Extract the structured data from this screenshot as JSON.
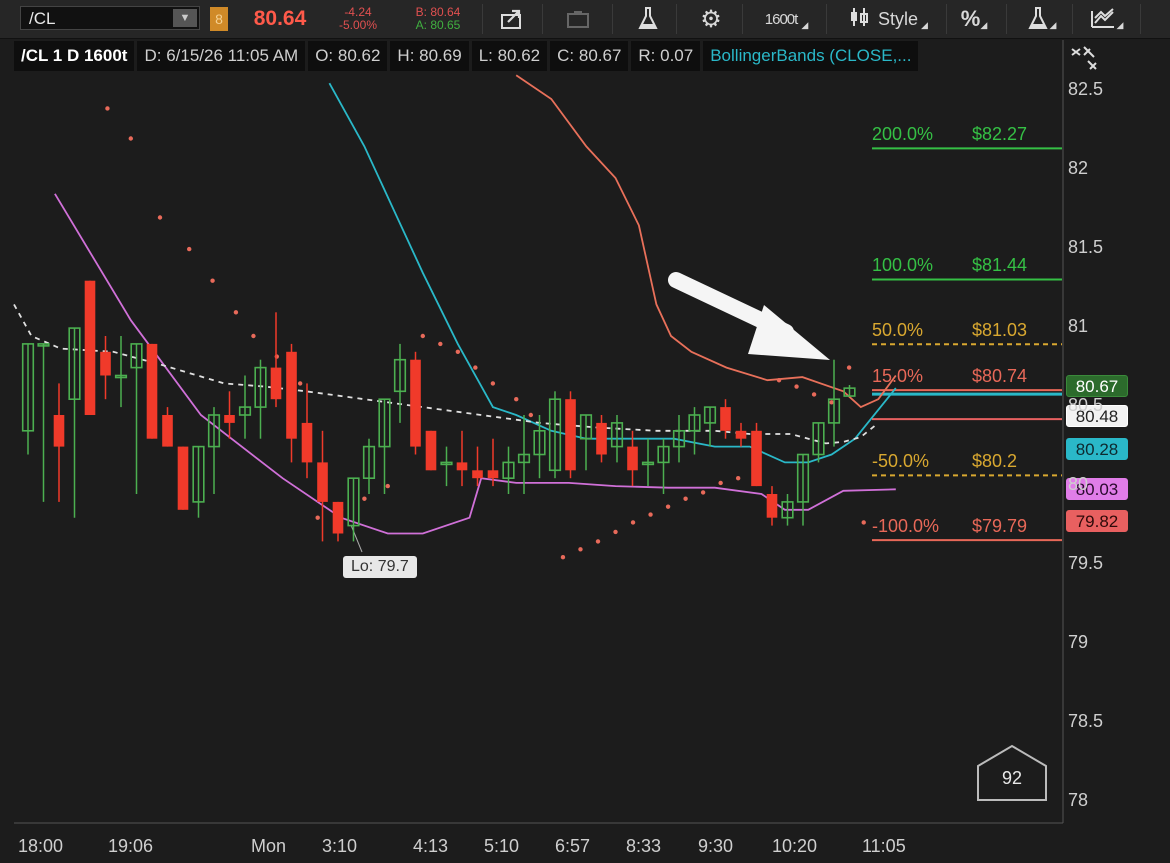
{
  "toolbar": {
    "symbol": "/CL",
    "link_badge": "8",
    "last_price": "80.64",
    "net_change": "-4.24",
    "pct_change": "-5.00%",
    "bid": "B: 80.64",
    "ask": "A: 80.65",
    "aggregation": "1600t",
    "style_label": "Style",
    "icons": [
      "share-icon",
      "screenshot-icon",
      "flask-icon",
      "gear-icon",
      "candle-style-icon",
      "percent-icon",
      "flask-icon",
      "drawing-icon"
    ]
  },
  "info": {
    "title": "/CL 1 D 1600t",
    "date": "D: 6/15/26 11:05 AM",
    "open": "O: 80.62",
    "high": "H: 80.69",
    "low": "L: 80.62",
    "close": "C: 80.67",
    "range": "R: 0.07",
    "study": "BollingerBands (CLOSE,..."
  },
  "colors": {
    "bg": "#1c1c1c",
    "up": "#4caf50",
    "down": "#f03a2a",
    "bb_upper": "#e8705a",
    "bb_lower": "#d070d8",
    "bb_mid": "#e0e0e0",
    "ma": "#2ab8c8",
    "sar": "#e86a5a",
    "fib_green": "#35c045",
    "fib_gold": "#d9a830",
    "fib_red": "#e86858"
  },
  "lo_label": "Lo: 79.7",
  "volume_badge": "92",
  "badges": [
    {
      "label": "80.67",
      "value": 80.67,
      "bg": "#2c6b2c",
      "fg": "#ffffff",
      "border": "#3a8a3a"
    },
    {
      "label": "80.48",
      "value": 80.48,
      "bg": "#f2f2f2",
      "fg": "#222222",
      "border": "#ffffff"
    },
    {
      "label": "80.28",
      "value": 80.28,
      "bg": "#2ab8c8",
      "fg": "#0e2a30",
      "border": "#2ab8c8"
    },
    {
      "label": "80.03",
      "value": 80.03,
      "bg": "#e07de8",
      "fg": "#2a0a2e",
      "border": "#e07de8"
    },
    {
      "label": "79.82",
      "value": 79.82,
      "bg": "#e86060",
      "fg": "#2e0a0a",
      "border": "#e86060"
    }
  ],
  "chart_data": {
    "type": "candlestick",
    "ylim": [
      78,
      82.6
    ],
    "y_ticks": [
      "82.5",
      "82",
      "81.5",
      "81",
      "80.5",
      "80",
      "79.5",
      "79",
      "78.5",
      "78"
    ],
    "x_labels": [
      "18:00",
      "19:06",
      "Mon",
      "3:10",
      "4:13",
      "5:10",
      "6:57",
      "8:33",
      "9:30",
      "10:20",
      "11:05"
    ],
    "fib_levels": [
      {
        "pct": "200.0%",
        "price": "$82.27",
        "value": 82.27,
        "color": "fib_green",
        "style": "solid"
      },
      {
        "pct": "100.0%",
        "price": "$81.44",
        "value": 81.44,
        "color": "fib_green",
        "style": "solid"
      },
      {
        "pct": "50.0%",
        "price": "$81.03",
        "value": 81.03,
        "color": "fib_gold",
        "style": "dashed"
      },
      {
        "pct": "15.0%",
        "price": "$80.74",
        "value": 80.74,
        "color": "fib_red",
        "style": "solid"
      },
      {
        "pct": "-50.0%",
        "price": "$80.2",
        "value": 80.2,
        "color": "fib_gold",
        "style": "dashed"
      },
      {
        "pct": "-100.0%",
        "price": "$79.79",
        "value": 79.79,
        "color": "fib_red",
        "style": "solid"
      }
    ],
    "candles": [
      {
        "o": 80.4,
        "h": 80.8,
        "l": 80.25,
        "c": 80.95
      },
      {
        "o": 80.95,
        "h": 80.95,
        "l": 79.95,
        "c": 80.95
      },
      {
        "o": 80.5,
        "h": 80.7,
        "l": 79.95,
        "c": 80.3
      },
      {
        "o": 80.6,
        "h": 80.9,
        "l": 79.85,
        "c": 81.05
      },
      {
        "o": 81.35,
        "h": 81.2,
        "l": 80.85,
        "c": 80.5
      },
      {
        "o": 80.9,
        "h": 81.0,
        "l": 80.6,
        "c": 80.75
      },
      {
        "o": 80.75,
        "h": 81.0,
        "l": 80.55,
        "c": 80.75
      },
      {
        "o": 80.8,
        "h": 80.95,
        "l": 80.0,
        "c": 80.95
      },
      {
        "o": 80.95,
        "h": 80.95,
        "l": 80.4,
        "c": 80.35
      },
      {
        "o": 80.5,
        "h": 80.55,
        "l": 80.3,
        "c": 80.3
      },
      {
        "o": 80.3,
        "h": 80.3,
        "l": 80.05,
        "c": 79.9
      },
      {
        "o": 79.95,
        "h": 80.3,
        "l": 79.85,
        "c": 80.3
      },
      {
        "o": 80.3,
        "h": 80.55,
        "l": 80.0,
        "c": 80.5
      },
      {
        "o": 80.5,
        "h": 80.65,
        "l": 80.35,
        "c": 80.45
      },
      {
        "o": 80.5,
        "h": 80.75,
        "l": 80.35,
        "c": 80.55
      },
      {
        "o": 80.55,
        "h": 80.85,
        "l": 80.35,
        "c": 80.8
      },
      {
        "o": 80.8,
        "h": 81.15,
        "l": 80.55,
        "c": 80.6
      },
      {
        "o": 80.9,
        "h": 80.95,
        "l": 80.2,
        "c": 80.35
      },
      {
        "o": 80.45,
        "h": 80.7,
        "l": 80.1,
        "c": 80.2
      },
      {
        "o": 80.2,
        "h": 80.4,
        "l": 79.7,
        "c": 79.95
      },
      {
        "o": 79.95,
        "h": 79.95,
        "l": 79.7,
        "c": 79.75
      },
      {
        "o": 79.8,
        "h": 80.0,
        "l": 79.7,
        "c": 80.1
      },
      {
        "o": 80.1,
        "h": 80.35,
        "l": 80.0,
        "c": 80.3
      },
      {
        "o": 80.3,
        "h": 80.6,
        "l": 80.0,
        "c": 80.6
      },
      {
        "o": 80.65,
        "h": 80.95,
        "l": 80.45,
        "c": 80.85
      },
      {
        "o": 80.85,
        "h": 80.9,
        "l": 80.25,
        "c": 80.3
      },
      {
        "o": 80.4,
        "h": 80.4,
        "l": 80.15,
        "c": 80.15
      },
      {
        "o": 80.2,
        "h": 80.3,
        "l": 80.05,
        "c": 80.2
      },
      {
        "o": 80.2,
        "h": 80.4,
        "l": 80.05,
        "c": 80.15
      },
      {
        "o": 80.15,
        "h": 80.3,
        "l": 80.05,
        "c": 80.1
      },
      {
        "o": 80.15,
        "h": 80.35,
        "l": 80.05,
        "c": 80.1
      },
      {
        "o": 80.1,
        "h": 80.3,
        "l": 80.0,
        "c": 80.2
      },
      {
        "o": 80.2,
        "h": 80.5,
        "l": 80.0,
        "c": 80.25
      },
      {
        "o": 80.25,
        "h": 80.5,
        "l": 80.1,
        "c": 80.4
      },
      {
        "o": 80.15,
        "h": 80.65,
        "l": 80.1,
        "c": 80.6
      },
      {
        "o": 80.6,
        "h": 80.65,
        "l": 80.1,
        "c": 80.15
      },
      {
        "o": 80.35,
        "h": 80.5,
        "l": 80.15,
        "c": 80.5
      },
      {
        "o": 80.45,
        "h": 80.5,
        "l": 80.2,
        "c": 80.25
      },
      {
        "o": 80.3,
        "h": 80.5,
        "l": 80.2,
        "c": 80.45
      },
      {
        "o": 80.3,
        "h": 80.4,
        "l": 80.05,
        "c": 80.15
      },
      {
        "o": 80.2,
        "h": 80.35,
        "l": 80.05,
        "c": 80.2
      },
      {
        "o": 80.2,
        "h": 80.35,
        "l": 80.0,
        "c": 80.3
      },
      {
        "o": 80.3,
        "h": 80.5,
        "l": 80.2,
        "c": 80.4
      },
      {
        "o": 80.4,
        "h": 80.55,
        "l": 80.25,
        "c": 80.5
      },
      {
        "o": 80.45,
        "h": 80.55,
        "l": 80.3,
        "c": 80.55
      },
      {
        "o": 80.55,
        "h": 80.6,
        "l": 80.35,
        "c": 80.4
      },
      {
        "o": 80.4,
        "h": 80.45,
        "l": 80.3,
        "c": 80.35
      },
      {
        "o": 80.4,
        "h": 80.45,
        "l": 80.1,
        "c": 80.05
      },
      {
        "o": 80.0,
        "h": 80.05,
        "l": 79.8,
        "c": 79.85
      },
      {
        "o": 79.85,
        "h": 80.0,
        "l": 79.8,
        "c": 79.95
      },
      {
        "o": 79.95,
        "h": 80.25,
        "l": 79.8,
        "c": 80.25
      },
      {
        "o": 80.25,
        "h": 80.45,
        "l": 80.2,
        "c": 80.45
      },
      {
        "o": 80.45,
        "h": 80.85,
        "l": 80.3,
        "c": 80.6
      },
      {
        "o": 80.62,
        "h": 80.69,
        "l": 80.62,
        "c": 80.67
      }
    ],
    "series": [
      {
        "key": "bb_upper",
        "points": [
          [
            8.6,
            82.65
          ],
          [
            9.2,
            82.5
          ],
          [
            9.8,
            82.2
          ],
          [
            10.3,
            82.0
          ],
          [
            10.7,
            81.7
          ],
          [
            11.0,
            81.2
          ],
          [
            11.25,
            81.0
          ],
          [
            11.6,
            80.9
          ],
          [
            12.2,
            80.8
          ],
          [
            12.9,
            80.72
          ],
          [
            13.5,
            80.74
          ],
          [
            14.2,
            80.65
          ],
          [
            14.5,
            80.55
          ],
          [
            14.8,
            80.6
          ],
          [
            15.1,
            80.75
          ]
        ]
      },
      {
        "key": "ma",
        "points": [
          [
            5.4,
            82.6
          ],
          [
            6.0,
            82.2
          ],
          [
            6.5,
            81.8
          ],
          [
            7.0,
            81.4
          ],
          [
            7.6,
            80.95
          ],
          [
            8.2,
            80.55
          ],
          [
            8.6,
            80.5
          ],
          [
            9.2,
            80.4
          ],
          [
            9.8,
            80.35
          ],
          [
            10.5,
            80.35
          ],
          [
            11.3,
            80.35
          ],
          [
            12.0,
            80.3
          ],
          [
            12.6,
            80.3
          ],
          [
            13.2,
            80.2
          ],
          [
            13.6,
            80.2
          ],
          [
            14.0,
            80.25
          ],
          [
            14.4,
            80.35
          ],
          [
            15.1,
            80.67
          ]
        ]
      },
      {
        "key": "bb_lower",
        "points": [
          [
            0.7,
            81.9
          ],
          [
            2.0,
            81.1
          ],
          [
            3.2,
            80.5
          ],
          [
            4.6,
            80.1
          ],
          [
            5.6,
            79.85
          ],
          [
            6.4,
            79.75
          ],
          [
            7.0,
            79.75
          ],
          [
            7.8,
            79.85
          ],
          [
            8.0,
            80.1
          ],
          [
            8.6,
            80.07
          ],
          [
            9.5,
            80.07
          ],
          [
            10.3,
            80.05
          ],
          [
            11.2,
            80.04
          ],
          [
            12.0,
            80.04
          ],
          [
            12.8,
            80.0
          ],
          [
            13.2,
            79.9
          ],
          [
            13.6,
            79.9
          ],
          [
            14.2,
            80.02
          ],
          [
            15.1,
            80.03
          ]
        ]
      },
      {
        "key": "bb_mid",
        "points": [
          [
            0.0,
            81.2
          ],
          [
            0.3,
            81.0
          ],
          [
            0.8,
            80.92
          ],
          [
            1.7,
            80.9
          ],
          [
            2.5,
            80.82
          ],
          [
            3.6,
            80.7
          ],
          [
            4.3,
            80.68
          ],
          [
            5.0,
            80.65
          ],
          [
            6.0,
            80.6
          ],
          [
            7.0,
            80.55
          ],
          [
            8.0,
            80.5
          ],
          [
            9.0,
            80.45
          ],
          [
            10.0,
            80.42
          ],
          [
            11.0,
            80.4
          ],
          [
            12.0,
            80.4
          ],
          [
            12.6,
            80.38
          ],
          [
            13.3,
            80.38
          ],
          [
            13.9,
            80.32
          ],
          [
            14.2,
            80.33
          ],
          [
            14.5,
            80.36
          ],
          [
            14.8,
            80.45
          ]
        ]
      }
    ],
    "sar": [
      [
        1.6,
        82.44
      ],
      [
        2.0,
        82.25
      ],
      [
        2.5,
        81.75
      ],
      [
        3.0,
        81.55
      ],
      [
        3.4,
        81.35
      ],
      [
        3.8,
        81.15
      ],
      [
        4.1,
        81.0
      ],
      [
        4.5,
        80.87
      ],
      [
        4.9,
        80.7
      ],
      [
        5.2,
        79.85
      ],
      [
        5.6,
        79.9
      ],
      [
        6.0,
        79.97
      ],
      [
        6.4,
        80.05
      ],
      [
        7.0,
        81.0
      ],
      [
        7.3,
        80.95
      ],
      [
        7.6,
        80.9
      ],
      [
        7.9,
        80.8
      ],
      [
        8.2,
        80.7
      ],
      [
        8.6,
        80.6
      ],
      [
        8.85,
        80.5
      ],
      [
        9.4,
        79.6
      ],
      [
        9.7,
        79.65
      ],
      [
        10.0,
        79.7
      ],
      [
        10.3,
        79.76
      ],
      [
        10.6,
        79.82
      ],
      [
        10.9,
        79.87
      ],
      [
        11.2,
        79.92
      ],
      [
        11.5,
        79.97
      ],
      [
        11.8,
        80.01
      ],
      [
        12.1,
        80.07
      ],
      [
        12.4,
        80.1
      ],
      [
        12.7,
        80.14
      ],
      [
        13.1,
        80.72
      ],
      [
        13.4,
        80.68
      ],
      [
        13.7,
        80.63
      ],
      [
        14.0,
        80.58
      ],
      [
        14.3,
        80.8
      ],
      [
        14.55,
        79.82
      ]
    ]
  }
}
